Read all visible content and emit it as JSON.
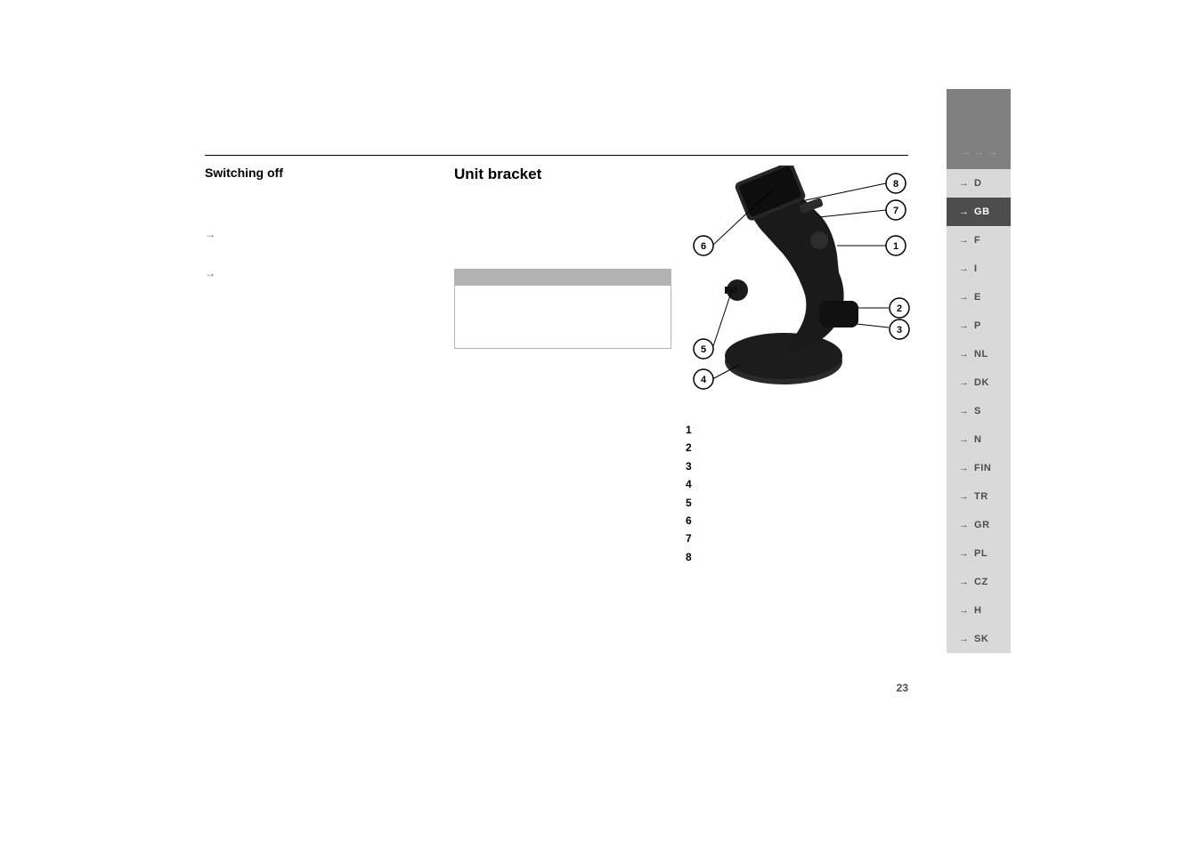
{
  "sidebar": {
    "topArrows": "→→→",
    "langs": [
      {
        "code": "D",
        "active": false
      },
      {
        "code": "GB",
        "active": true
      },
      {
        "code": "F",
        "active": false
      },
      {
        "code": "I",
        "active": false
      },
      {
        "code": "E",
        "active": false
      },
      {
        "code": "P",
        "active": false
      },
      {
        "code": "NL",
        "active": false
      },
      {
        "code": "DK",
        "active": false
      },
      {
        "code": "S",
        "active": false
      },
      {
        "code": "N",
        "active": false
      },
      {
        "code": "FIN",
        "active": false
      },
      {
        "code": "TR",
        "active": false
      },
      {
        "code": "GR",
        "active": false
      },
      {
        "code": "PL",
        "active": false
      },
      {
        "code": "CZ",
        "active": false
      },
      {
        "code": "H",
        "active": false
      },
      {
        "code": "SK",
        "active": false
      }
    ]
  },
  "leftCol": {
    "heading": "Switching off"
  },
  "midCol": {
    "heading": "Unit bracket"
  },
  "callouts": {
    "1": "1",
    "2": "2",
    "3": "3",
    "4": "4",
    "5": "5",
    "6": "6",
    "7": "7",
    "8": "8"
  },
  "legend": [
    {
      "n": "1",
      "t": ""
    },
    {
      "n": "2",
      "t": ""
    },
    {
      "n": "3",
      "t": ""
    },
    {
      "n": "4",
      "t": ""
    },
    {
      "n": "5",
      "t": ""
    },
    {
      "n": "6",
      "t": ""
    },
    {
      "n": "7",
      "t": ""
    },
    {
      "n": "8",
      "t": ""
    }
  ],
  "pageNumber": "23"
}
